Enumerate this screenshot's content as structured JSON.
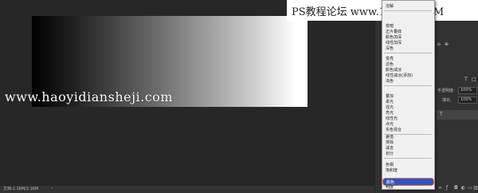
{
  "watermarks": {
    "left": "www.haoyidiansheji.com",
    "right_brand": "PS教程论坛",
    "right_url": "www.16XX8.COM"
  },
  "status": {
    "doc_info": "文档:2.16M/2.16M",
    "arrow": "›"
  },
  "panel": {
    "opacity_label": "不透明度:",
    "opacity_value": "100%",
    "fill_label": "填充:",
    "fill_value": "100%",
    "filter_letter": "T",
    "layer_letter": "T"
  },
  "blend_menu": {
    "groups": [
      [
        "溶解"
      ],
      [
        "变暗",
        "正片叠底",
        "颜色加深",
        "线性加深",
        "深色"
      ],
      [
        "变亮",
        "滤色",
        "颜色减淡",
        "线性减淡(添加)",
        "浅色"
      ],
      [
        "叠加",
        "柔光",
        "强光",
        "亮光",
        "线性光",
        "点光",
        "实色混合"
      ],
      [
        "差值",
        "排除",
        "减去",
        "划分"
      ],
      [
        "色相",
        "饱和度"
      ]
    ],
    "selected": "颜色",
    "after_selected": "明度"
  }
}
